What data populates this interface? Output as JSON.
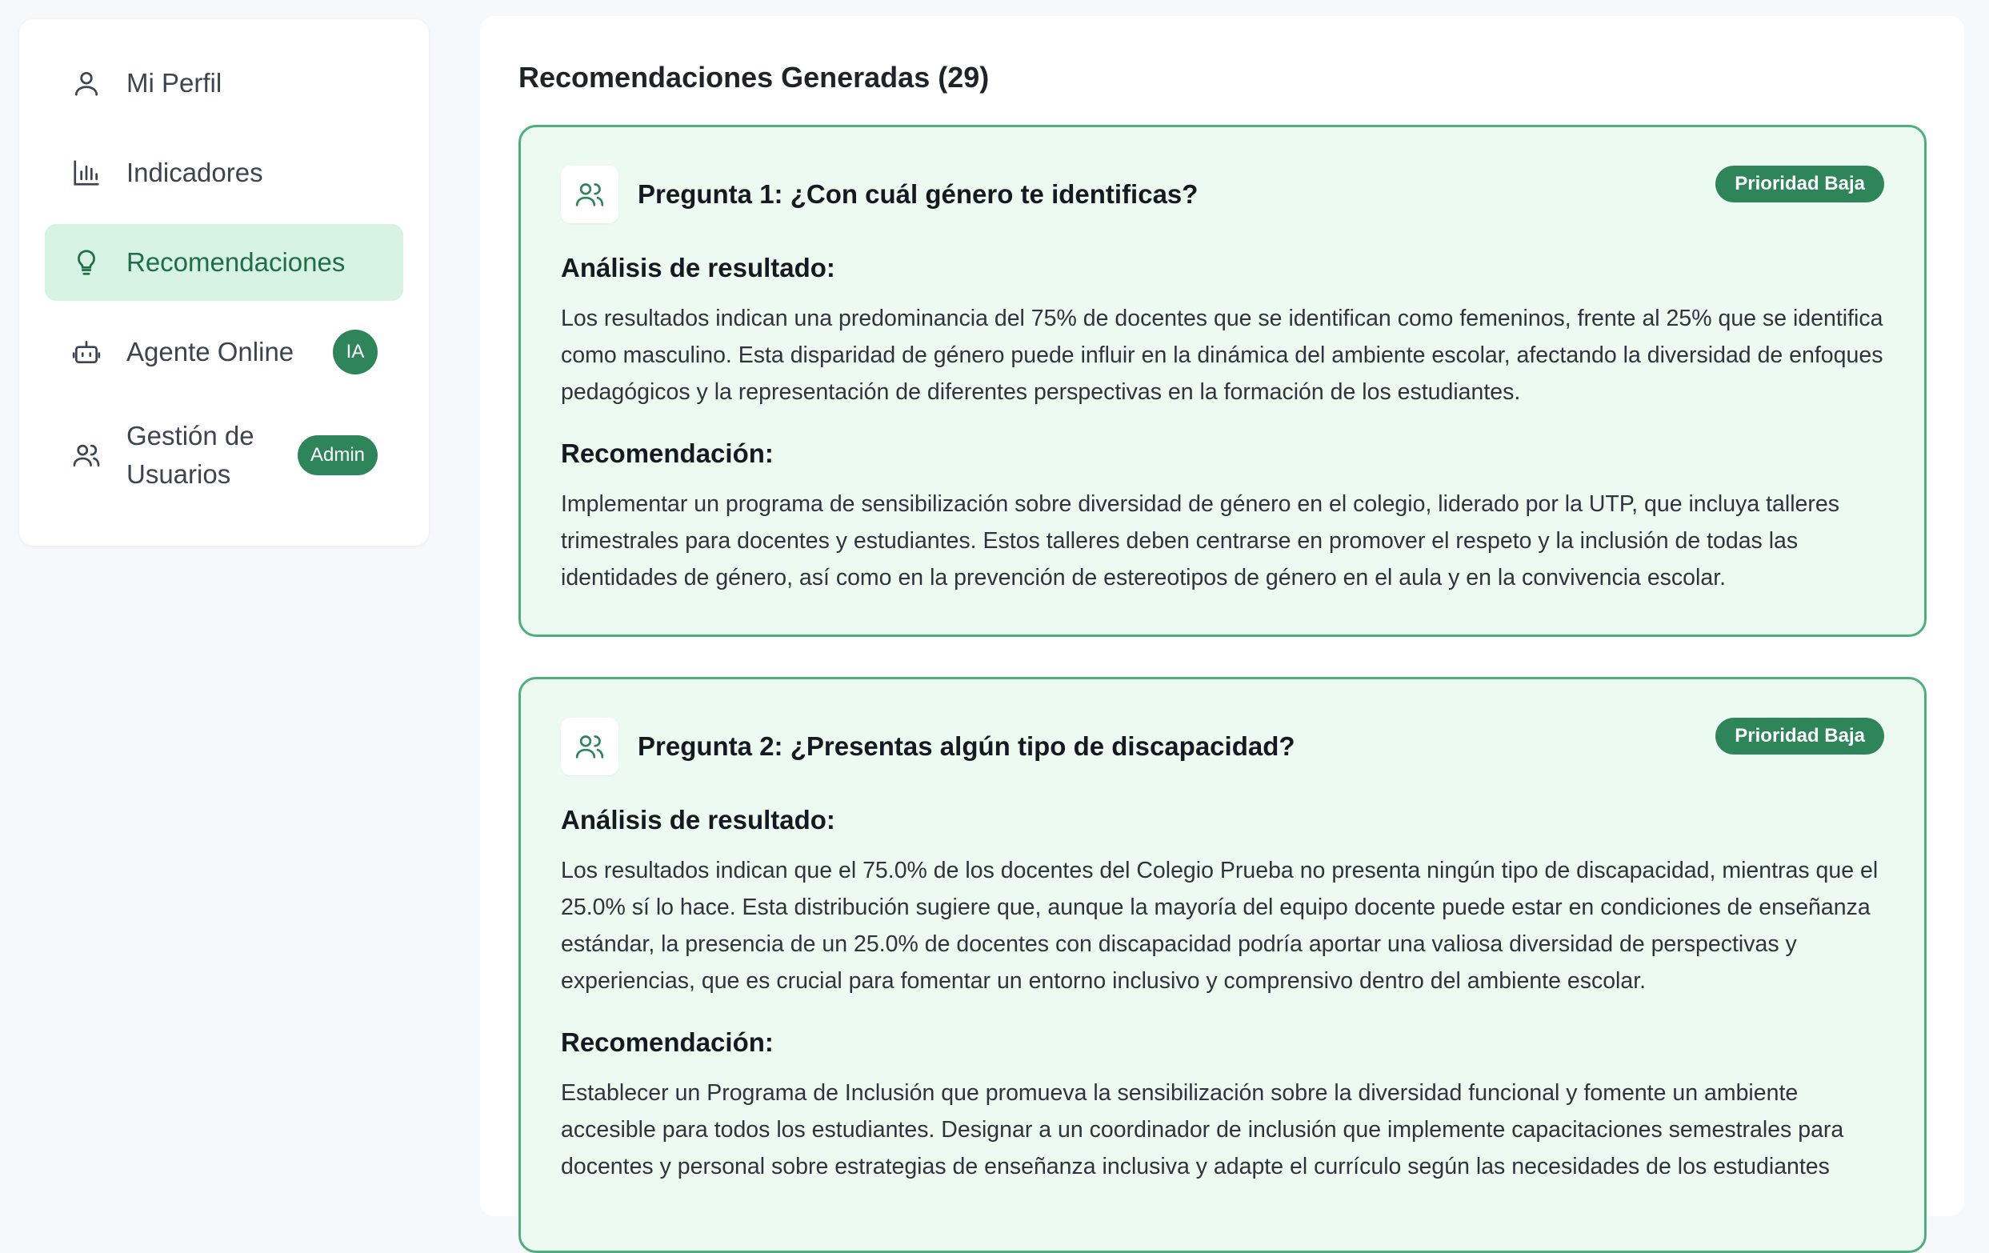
{
  "sidebar": {
    "items": [
      {
        "label": "Mi Perfil",
        "icon": "user-icon"
      },
      {
        "label": "Indicadores",
        "icon": "bar-chart-icon"
      },
      {
        "label": "Recomendaciones",
        "icon": "lightbulb-icon",
        "active": true
      },
      {
        "label": "Agente Online",
        "icon": "robot-icon",
        "badge": "IA"
      },
      {
        "label": "Gestión de Usuarios",
        "icon": "users-icon",
        "badge": "Admin"
      }
    ]
  },
  "main": {
    "title": "Recomendaciones Generadas (29)",
    "cards": [
      {
        "question": "Pregunta 1: ¿Con cuál género te identificas?",
        "priority": "Prioridad Baja",
        "analysis_title": "Análisis de resultado:",
        "analysis": "Los resultados indican una predominancia del 75% de docentes que se identifican como femeninos, frente al 25% que se identifica como masculino. Esta disparidad de género puede influir en la dinámica del ambiente escolar, afectando la diversidad de enfoques pedagógicos y la representación de diferentes perspectivas en la formación de los estudiantes.",
        "recommendation_title": "Recomendación:",
        "recommendation": "Implementar un programa de sensibilización sobre diversidad de género en el colegio, liderado por la UTP, que incluya talleres trimestrales para docentes y estudiantes. Estos talleres deben centrarse en promover el respeto y la inclusión de todas las identidades de género, así como en la prevención de estereotipos de género en el aula y en la convivencia escolar."
      },
      {
        "question": "Pregunta 2: ¿Presentas algún tipo de discapacidad?",
        "priority": "Prioridad Baja",
        "analysis_title": "Análisis de resultado:",
        "analysis": "Los resultados indican que el 75.0% de los docentes del Colegio Prueba no presenta ningún tipo de discapacidad, mientras que el 25.0% sí lo hace. Esta distribución sugiere que, aunque la mayoría del equipo docente puede estar en condiciones de enseñanza estándar, la presencia de un 25.0% de docentes con discapacidad podría aportar una valiosa diversidad de perspectivas y experiencias, que es crucial para fomentar un entorno inclusivo y comprensivo dentro del ambiente escolar.",
        "recommendation_title": "Recomendación:",
        "recommendation": "Establecer un Programa de Inclusión que promueva la sensibilización sobre la diversidad funcional y fomente un ambiente accesible para todos los estudiantes. Designar a un coordinador de inclusión que implemente capacitaciones semestrales para docentes y personal sobre estrategias de enseñanza inclusiva y adapte el currículo según las necesidades de los estudiantes"
      }
    ]
  },
  "colors": {
    "accent": "#2f855a",
    "active_bg": "#d7f3e3",
    "card_bg": "#edfaf2",
    "card_border": "#4caf7d"
  }
}
